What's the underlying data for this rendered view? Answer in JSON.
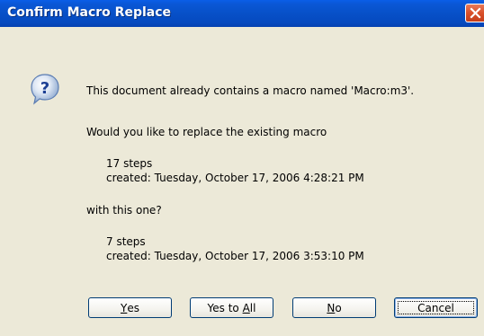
{
  "window": {
    "title": "Confirm Macro Replace"
  },
  "message": {
    "line1": "This document already contains a macro named 'Macro:m3'.",
    "line2": "Would you like to replace the existing macro",
    "existing_steps": "17 steps",
    "existing_created": "created: Tuesday, October 17, 2006 4:28:21 PM",
    "line3": "with this one?",
    "new_steps": "7 steps",
    "new_created": "created: Tuesday, October 17, 2006 3:53:10 PM"
  },
  "buttons": {
    "yes_pre": "",
    "yes_mnemonic": "Y",
    "yes_post": "es",
    "yes_all_pre": "Yes to ",
    "yes_all_mnemonic": "A",
    "yes_all_post": "ll",
    "no_pre": "",
    "no_mnemonic": "N",
    "no_post": "o",
    "cancel": "Cancel"
  },
  "icons": {
    "dialog_icon": "question-icon",
    "close": "close-icon"
  },
  "colors": {
    "titlebar": "#0750c8",
    "dialog_bg": "#ece9d8",
    "close_button": "#d9502a"
  }
}
